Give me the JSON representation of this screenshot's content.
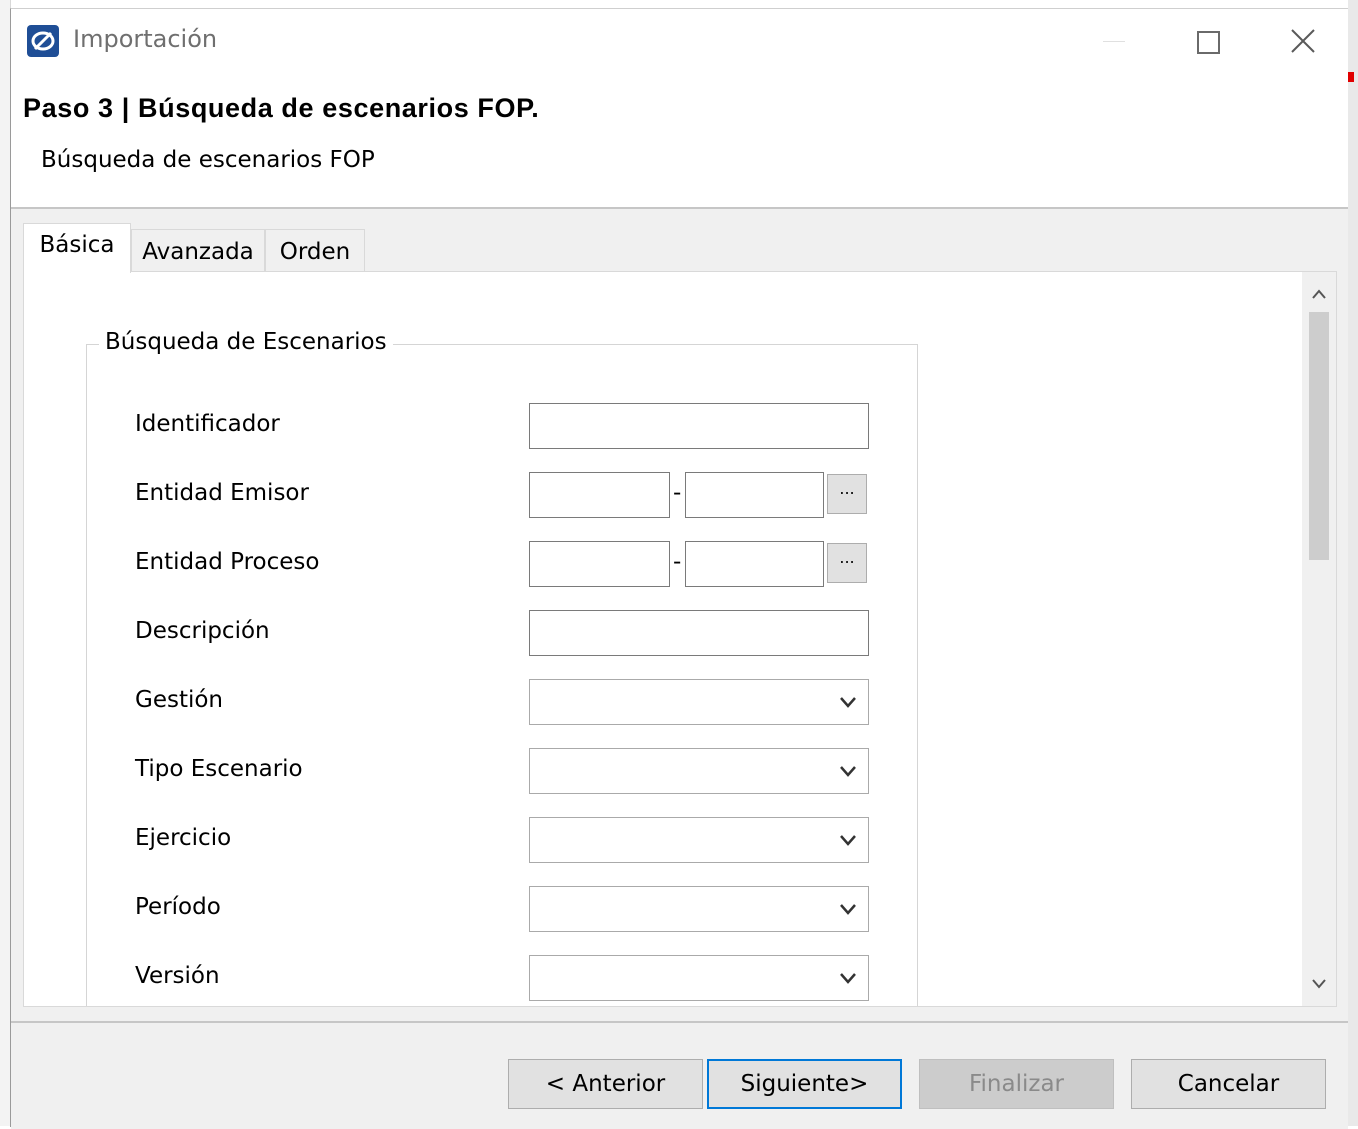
{
  "window": {
    "title": "Importación",
    "title_icon": "app-logo-icon",
    "controls": [
      "minimize-icon",
      "maximize-icon",
      "close-icon"
    ]
  },
  "header": {
    "step_title": "Paso 3 | Búsqueda de escenarios FOP.",
    "subtitle": "Búsqueda de escenarios FOP"
  },
  "tabs": [
    {
      "label": "Básica",
      "active": true
    },
    {
      "label": "Avanzada",
      "active": false
    },
    {
      "label": "Orden",
      "active": false
    }
  ],
  "search_group": {
    "legend": "Búsqueda de Escenarios",
    "fields": {
      "identificador": {
        "label": "Identificador",
        "value": ""
      },
      "entidad_emisor": {
        "label": "Entidad Emisor",
        "from": "",
        "to": "",
        "separator": "-",
        "browse_label": "..."
      },
      "entidad_proceso": {
        "label": "Entidad Proceso",
        "from": "",
        "to": "",
        "separator": "-",
        "browse_label": "..."
      },
      "descripcion": {
        "label": "Descripción",
        "value": ""
      },
      "gestion": {
        "label": "Gestión",
        "selected": ""
      },
      "tipo_escenario": {
        "label": "Tipo Escenario",
        "selected": ""
      },
      "ejercicio": {
        "label": "Ejercicio",
        "selected": ""
      },
      "periodo": {
        "label": "Período",
        "selected": ""
      },
      "version": {
        "label": "Versión",
        "selected": ""
      }
    }
  },
  "footer": {
    "anterior": "< Anterior",
    "siguiente": "Siguiente>",
    "finalizar": "Finalizar",
    "cancelar": "Cancelar"
  },
  "colors": {
    "focus_border": "#0078d7",
    "disabled_text": "#8a8a8a",
    "app_icon": "#1f4e96",
    "background": "#f0f0f0"
  }
}
